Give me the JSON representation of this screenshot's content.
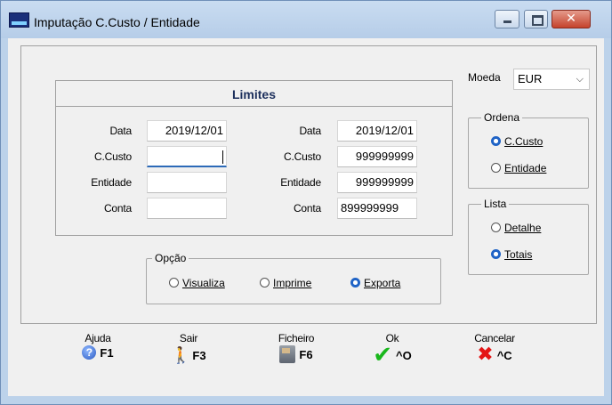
{
  "window": {
    "title": "Imputação C.Custo / Entidade",
    "close_glyph": "✕"
  },
  "limits": {
    "title": "Limites",
    "left": [
      {
        "label": "Data",
        "value": "2019/12/01"
      },
      {
        "label": "C.Custo",
        "value": ""
      },
      {
        "label": "Entidade",
        "value": ""
      },
      {
        "label": "Conta",
        "value": ""
      }
    ],
    "right": [
      {
        "label": "Data",
        "value": "2019/12/01"
      },
      {
        "label": "C.Custo",
        "value": "999999999"
      },
      {
        "label": "Entidade",
        "value": "999999999"
      },
      {
        "label": "Conta",
        "value": "899999999"
      }
    ]
  },
  "moeda": {
    "label": "Moeda",
    "selected": "EUR"
  },
  "ordena": {
    "legend": "Ordena",
    "options": [
      {
        "label": "C.Custo",
        "selected": true
      },
      {
        "label": "Entidade",
        "selected": false
      }
    ]
  },
  "lista": {
    "legend": "Lista",
    "options": [
      {
        "label": "Detalhe",
        "selected": false
      },
      {
        "label": "Totais",
        "selected": true
      }
    ]
  },
  "opcao": {
    "legend": "Opção",
    "options": [
      {
        "label": "Visualiza",
        "selected": false
      },
      {
        "label": "Imprime",
        "selected": false
      },
      {
        "label": "Exporta",
        "selected": true
      }
    ]
  },
  "toolbar": [
    {
      "label": "Ajuda",
      "key": "F1",
      "icon": "help-icon"
    },
    {
      "label": "Sair",
      "key": "F3",
      "icon": "exit-door-icon"
    },
    {
      "label": "Ficheiro",
      "key": "F6",
      "icon": "file-cabinet-icon"
    },
    {
      "label": "Ok",
      "key": "^O",
      "icon": "checkmark-icon"
    },
    {
      "label": "Cancelar",
      "key": "^C",
      "icon": "cancel-x-icon"
    }
  ],
  "colors": {
    "accent": "#1f63c6",
    "ok": "#19b71c",
    "cancel": "#e41616",
    "titlebar": "#bcd2ea"
  }
}
